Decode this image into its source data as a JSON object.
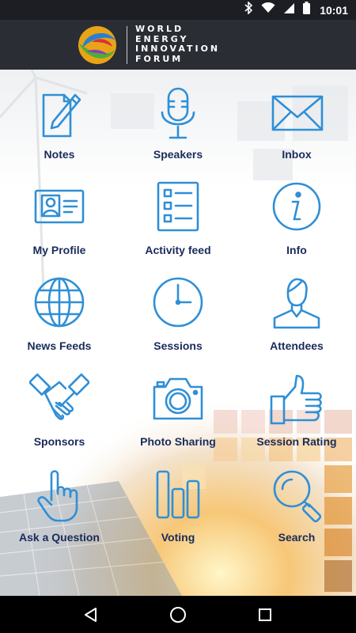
{
  "status_bar": {
    "time": "10:01",
    "icons": [
      "bluetooth-icon",
      "wifi-icon",
      "signal-icon",
      "battery-icon"
    ]
  },
  "header": {
    "logo_lines": [
      "WORLD",
      "ENERGY",
      "INNOVATION",
      "FORUM"
    ]
  },
  "menu": {
    "items": [
      {
        "label": "Notes",
        "icon": "notes-icon"
      },
      {
        "label": "Speakers",
        "icon": "microphone-icon"
      },
      {
        "label": "Inbox",
        "icon": "envelope-icon"
      },
      {
        "label": "My Profile",
        "icon": "id-card-icon"
      },
      {
        "label": "Activity feed",
        "icon": "list-icon"
      },
      {
        "label": "Info",
        "icon": "info-icon"
      },
      {
        "label": "News Feeds",
        "icon": "globe-icon"
      },
      {
        "label": "Sessions",
        "icon": "clock-icon"
      },
      {
        "label": "Attendees",
        "icon": "person-icon"
      },
      {
        "label": "Sponsors",
        "icon": "handshake-icon"
      },
      {
        "label": "Photo Sharing",
        "icon": "camera-icon"
      },
      {
        "label": "Session Rating",
        "icon": "thumbs-up-icon"
      },
      {
        "label": "Ask a Question",
        "icon": "pointing-hand-icon"
      },
      {
        "label": "Voting",
        "icon": "bar-chart-icon"
      },
      {
        "label": "Search",
        "icon": "search-icon"
      }
    ]
  },
  "navigation": {
    "buttons": [
      "back-icon",
      "home-icon",
      "recents-icon"
    ]
  },
  "colors": {
    "icon_blue": "#2f8fd6",
    "label_navy": "#1a2b5c",
    "header_bg": "#2a2d33",
    "status_bg": "#1c1e24"
  }
}
